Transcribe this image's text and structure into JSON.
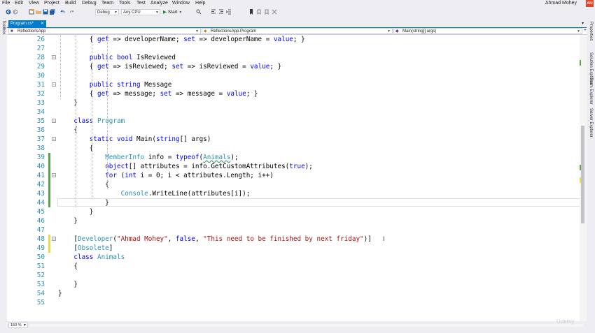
{
  "menu": [
    "File",
    "Edit",
    "View",
    "Project",
    "Build",
    "Debug",
    "Team",
    "Tools",
    "Test",
    "Analyze",
    "Window",
    "Help"
  ],
  "user": {
    "name": "Ahmad Mohey",
    "initials": "AM"
  },
  "toolbar": {
    "configuration": "Debug",
    "platform": "Any CPU",
    "start_label": "Start"
  },
  "left_rail": {
    "toolbox": "Toolbox"
  },
  "right_rail": [
    "Properties",
    "Solution Explorer",
    "Team Explorer",
    "Server Explorer"
  ],
  "tab": {
    "name": "Program.cs*"
  },
  "nav": {
    "project": "ReflectionsApp",
    "type": "ReflectionsApp.Program",
    "member": "Main(string[] args)"
  },
  "zoom": "150 %",
  "watermark": "Udemy",
  "code_lines": [
    {
      "n": "26",
      "tokens": [
        {
          "t": "{ "
        },
        {
          "t": "get",
          "c": "kw"
        },
        {
          "t": " => developerName; "
        },
        {
          "t": "set",
          "c": "kw"
        },
        {
          "t": " => developerName = "
        },
        {
          "t": "value",
          "c": "kw"
        },
        {
          "t": "; }"
        }
      ]
    },
    {
      "n": "27",
      "tokens": []
    },
    {
      "n": "28",
      "tokens": [
        {
          "t": "public",
          "c": "kw"
        },
        {
          "t": " "
        },
        {
          "t": "bool",
          "c": "kw"
        },
        {
          "t": " IsReviewed"
        }
      ]
    },
    {
      "n": "29",
      "tokens": [
        {
          "t": "{ "
        },
        {
          "t": "get",
          "c": "kw"
        },
        {
          "t": " => isReviewed; "
        },
        {
          "t": "set",
          "c": "kw"
        },
        {
          "t": " => isReviewed = "
        },
        {
          "t": "value",
          "c": "kw"
        },
        {
          "t": "; }"
        }
      ]
    },
    {
      "n": "30",
      "tokens": []
    },
    {
      "n": "31",
      "tokens": [
        {
          "t": "public",
          "c": "kw"
        },
        {
          "t": " "
        },
        {
          "t": "string",
          "c": "kw"
        },
        {
          "t": " Message"
        }
      ]
    },
    {
      "n": "32",
      "tokens": [
        {
          "t": "{ "
        },
        {
          "t": "get",
          "c": "kw"
        },
        {
          "t": " => message; "
        },
        {
          "t": "set",
          "c": "kw"
        },
        {
          "t": " => message = "
        },
        {
          "t": "value",
          "c": "kw"
        },
        {
          "t": "; }"
        }
      ]
    },
    {
      "n": "33",
      "tokens": [
        {
          "t": "}"
        }
      ]
    },
    {
      "n": "34",
      "tokens": []
    },
    {
      "n": "35",
      "tokens": [
        {
          "t": "class",
          "c": "kw"
        },
        {
          "t": " "
        },
        {
          "t": "Program",
          "c": "ty"
        }
      ]
    },
    {
      "n": "36",
      "tokens": [
        {
          "t": "{"
        }
      ]
    },
    {
      "n": "37",
      "tokens": [
        {
          "t": "static",
          "c": "kw"
        },
        {
          "t": " "
        },
        {
          "t": "void",
          "c": "kw"
        },
        {
          "t": " Main("
        },
        {
          "t": "string",
          "c": "kw"
        },
        {
          "t": "[] args)"
        }
      ]
    },
    {
      "n": "38",
      "tokens": [
        {
          "t": "{"
        }
      ]
    },
    {
      "n": "39",
      "tokens": [
        {
          "t": "MemberInfo",
          "c": "ty"
        },
        {
          "t": " info = "
        },
        {
          "t": "typeof",
          "c": "kw"
        },
        {
          "t": "("
        },
        {
          "t": "Animals",
          "c": "ty squig"
        },
        {
          "t": ");"
        }
      ]
    },
    {
      "n": "40",
      "tokens": [
        {
          "t": "object",
          "c": "kw"
        },
        {
          "t": "[] attributes = info.GetCustomAttributes("
        },
        {
          "t": "true",
          "c": "kw"
        },
        {
          "t": ");"
        }
      ]
    },
    {
      "n": "41",
      "tokens": [
        {
          "t": "for",
          "c": "kw"
        },
        {
          "t": " ("
        },
        {
          "t": "int",
          "c": "kw"
        },
        {
          "t": " i = 0; i < attributes.Length; i++)"
        }
      ]
    },
    {
      "n": "42",
      "tokens": [
        {
          "t": "{"
        }
      ]
    },
    {
      "n": "43",
      "tokens": [
        {
          "t": "Console",
          "c": "ty"
        },
        {
          "t": ".WriteLine(attributes[i]);"
        }
      ]
    },
    {
      "n": "44",
      "tokens": [
        {
          "t": "}"
        }
      ]
    },
    {
      "n": "45",
      "tokens": [
        {
          "t": "}"
        }
      ]
    },
    {
      "n": "46",
      "tokens": [
        {
          "t": "}"
        }
      ]
    },
    {
      "n": "47",
      "tokens": []
    },
    {
      "n": "48",
      "tokens": [
        {
          "t": "["
        },
        {
          "t": "Developer",
          "c": "ty"
        },
        {
          "t": "("
        },
        {
          "t": "\"Ahmad Mohey\"",
          "c": "str"
        },
        {
          "t": ", "
        },
        {
          "t": "false",
          "c": "kw"
        },
        {
          "t": ", "
        },
        {
          "t": "\"This need to be finished by next friday\"",
          "c": "str"
        },
        {
          "t": ")]"
        }
      ]
    },
    {
      "n": "49",
      "tokens": [
        {
          "t": "["
        },
        {
          "t": "Obsolete",
          "c": "ty"
        },
        {
          "t": "]"
        }
      ]
    },
    {
      "n": "50",
      "tokens": [
        {
          "t": "class",
          "c": "kw"
        },
        {
          "t": " "
        },
        {
          "t": "Animals",
          "c": "ty"
        }
      ]
    },
    {
      "n": "51",
      "tokens": [
        {
          "t": "{"
        }
      ]
    },
    {
      "n": "52",
      "tokens": []
    },
    {
      "n": "53",
      "tokens": [
        {
          "t": "}"
        }
      ]
    },
    {
      "n": "54",
      "tokens": [
        {
          "t": "}"
        }
      ]
    },
    {
      "n": "55",
      "tokens": []
    }
  ]
}
